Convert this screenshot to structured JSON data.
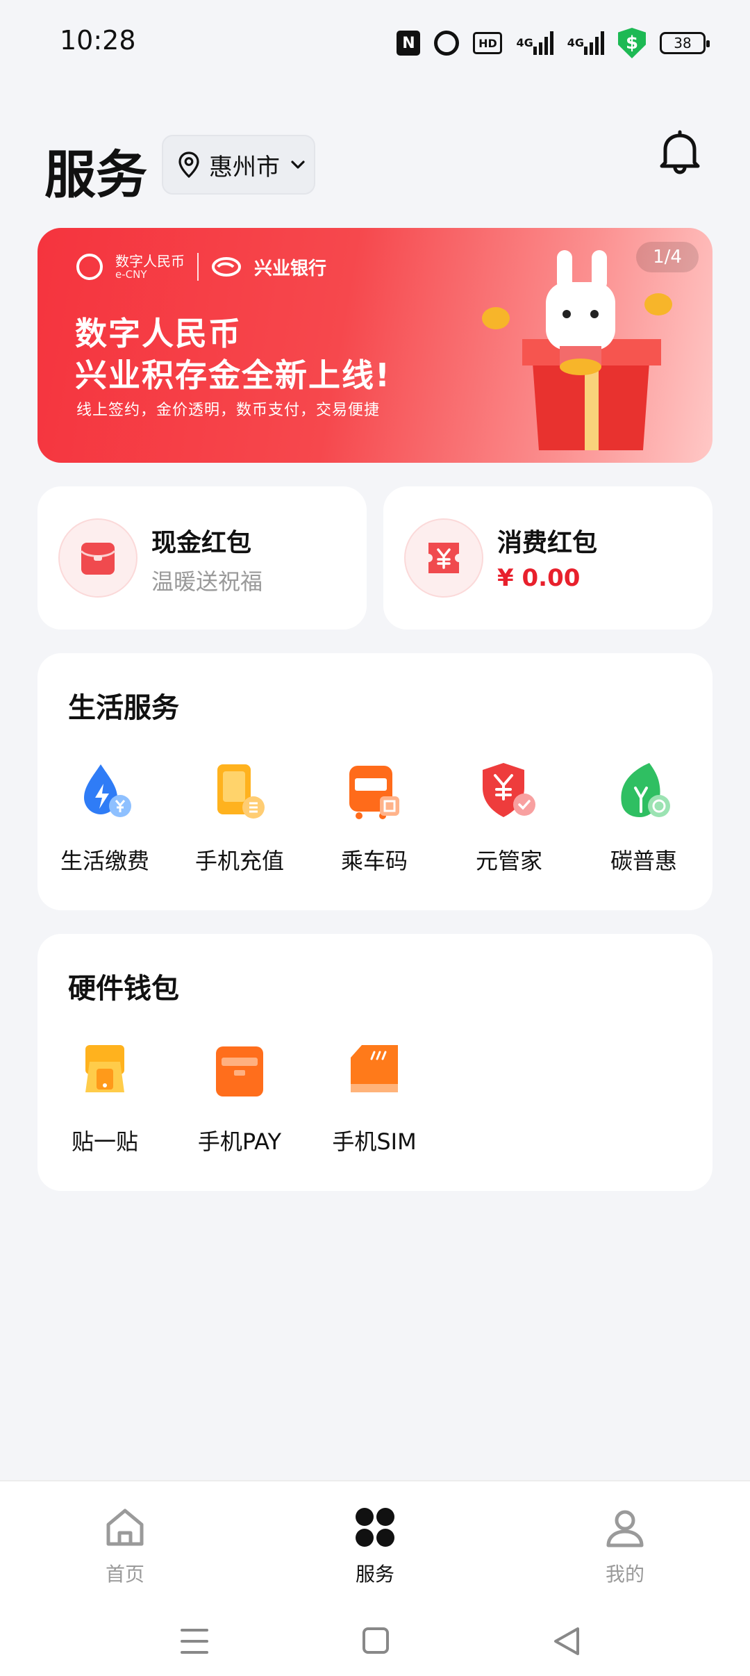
{
  "status_bar": {
    "time": "10:28",
    "nfc_label": "N",
    "hd_label": "HD",
    "signal1_label": "4G",
    "signal2_label": "4G",
    "shield_symbol": "$",
    "battery": "38",
    "icons": [
      "nfc-icon",
      "alarm-icon",
      "hd-icon",
      "signal-4g-icon",
      "signal-4g-icon",
      "security-shield-icon",
      "battery-icon"
    ]
  },
  "header": {
    "title": "服务",
    "city": "惠州市",
    "icons": [
      "location-pin-icon",
      "chevron-down-icon",
      "bell-icon"
    ]
  },
  "banner": {
    "logo_ecny_cn": "数字人民币",
    "logo_ecny_en": "e-CNY",
    "logo_bank": "兴业银行",
    "title_line1": "数字人民币",
    "title_line2": "兴业积存金全新上线!",
    "subtitle": "线上签约，金价透明，数币支付，交易便捷",
    "counter": "1/4"
  },
  "red_packets": {
    "cash": {
      "title": "现金红包",
      "subtitle": "温暖送祝福",
      "icon": "red-envelope-icon"
    },
    "consume": {
      "title": "消费红包",
      "amount": "¥ 0.00",
      "icon": "coupon-yuan-icon"
    }
  },
  "life_services": {
    "title": "生活服务",
    "items": [
      {
        "label": "生活缴费",
        "icon": "utility-bill-icon"
      },
      {
        "label": "手机充值",
        "icon": "phone-topup-icon"
      },
      {
        "label": "乘车码",
        "icon": "bus-code-icon"
      },
      {
        "label": "元管家",
        "icon": "wallet-guard-icon"
      },
      {
        "label": "碳普惠",
        "icon": "carbon-leaf-icon"
      }
    ]
  },
  "hardware_wallet": {
    "title": "硬件钱包",
    "items": [
      {
        "label": "贴一贴",
        "icon": "tap-pay-icon"
      },
      {
        "label": "手机PAY",
        "icon": "phone-pay-icon"
      },
      {
        "label": "手机SIM",
        "icon": "sim-card-icon"
      }
    ]
  },
  "bottom_nav": {
    "items": [
      {
        "label": "首页",
        "icon": "home-icon",
        "active": false
      },
      {
        "label": "服务",
        "icon": "services-grid-icon",
        "active": true
      },
      {
        "label": "我的",
        "icon": "profile-icon",
        "active": false
      }
    ]
  },
  "colors": {
    "brand_red": "#e8202c",
    "banner_start": "#f5343e",
    "background": "#f4f5f8",
    "orange": "#ff8a1f"
  }
}
